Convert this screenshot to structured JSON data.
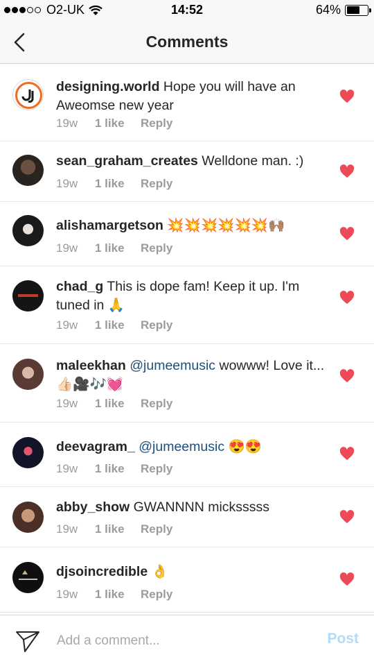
{
  "status_bar": {
    "carrier": "O2-UK",
    "time": "14:52",
    "battery": "64%",
    "battery_level": 0.64,
    "signal_bars": 3
  },
  "header": {
    "title": "Comments"
  },
  "comments": [
    {
      "username": "designing.world",
      "mention": "",
      "text": " Hope you will have an Aweomse new year",
      "time": "19w",
      "likes": "1 like",
      "reply": "Reply"
    },
    {
      "username": "sean_graham_creates",
      "mention": "",
      "text": " Welldone man. :)",
      "time": "19w",
      "likes": "1 like",
      "reply": "Reply"
    },
    {
      "username": "alishamargetson",
      "mention": "",
      "text": " 💥💥💥💥💥💥🙌🏽",
      "time": "19w",
      "likes": "1 like",
      "reply": "Reply"
    },
    {
      "username": "chad_g",
      "mention": "",
      "text": " This is dope fam! Keep it up. I'm tuned in 🙏",
      "time": "19w",
      "likes": "1 like",
      "reply": "Reply"
    },
    {
      "username": "maleekhan",
      "mention": " @jumeemusic",
      "text": "  wowww! Love it... 👍🏻🎥🎶💓",
      "time": "19w",
      "likes": "1 like",
      "reply": "Reply"
    },
    {
      "username": "deevagram_",
      "mention": " @jumeemusic",
      "text": " 😍😍",
      "time": "19w",
      "likes": "1 like",
      "reply": "Reply"
    },
    {
      "username": "abby_show",
      "mention": "",
      "text": " GWANNNN micksssss",
      "time": "19w",
      "likes": "1 like",
      "reply": "Reply"
    },
    {
      "username": "djsoincredible",
      "mention": "",
      "text": " 👌",
      "time": "19w",
      "likes": "1 like",
      "reply": "Reply"
    }
  ],
  "composer": {
    "placeholder": "Add a comment...",
    "post_label": "Post"
  },
  "colors": {
    "heart": "#ed4956",
    "mention": "#1d4f7c",
    "meta": "#9b9b9b",
    "post_disabled": "#b3dbf7"
  }
}
